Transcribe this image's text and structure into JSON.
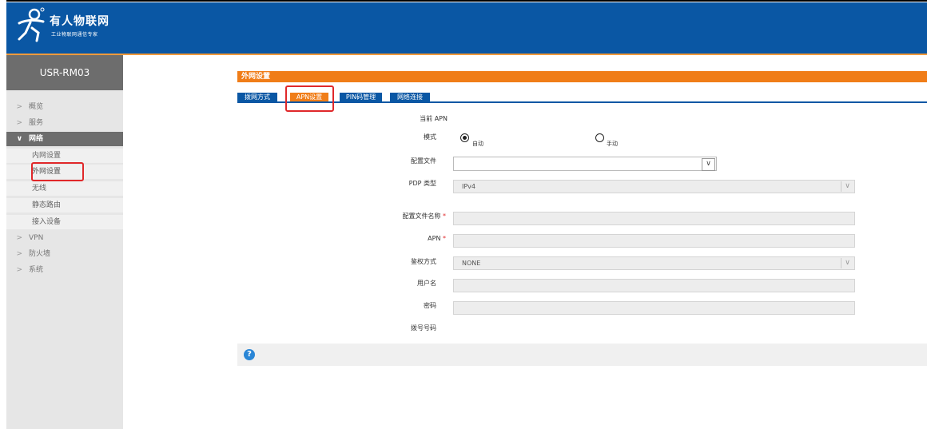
{
  "header": {
    "brand_name": "有人物联网",
    "brand_tagline": "工业物联网通信专家",
    "colors": {
      "header_bg": "#0a57a4",
      "accent": "#f07d18",
      "highlight_box": "#e0282a"
    }
  },
  "sidebar": {
    "device_name": "USR-RM03",
    "items": [
      {
        "label": "概览",
        "expanded": false
      },
      {
        "label": "服务",
        "expanded": false
      },
      {
        "label": "网络",
        "expanded": true
      },
      {
        "label": "VPN",
        "expanded": false
      },
      {
        "label": "防火墙",
        "expanded": false
      },
      {
        "label": "系统",
        "expanded": false
      }
    ],
    "subitems": [
      {
        "label": "内网设置"
      },
      {
        "label": "外网设置"
      },
      {
        "label": "无线"
      },
      {
        "label": "静态路由"
      },
      {
        "label": "接入设备"
      }
    ]
  },
  "main": {
    "section_title": "外网设置",
    "tabs": [
      {
        "label": "拨网方式"
      },
      {
        "label": "APN设置"
      },
      {
        "label": "PIN码管理"
      },
      {
        "label": "网络连接"
      }
    ],
    "form": {
      "current_apn_label": "当前 APN",
      "mode_label": "模式",
      "mode_options": [
        "自动",
        "手动"
      ],
      "mode_selected": "自动",
      "profile_label": "配置文件",
      "profile_value": "",
      "pdp_type_label": "PDP 类型",
      "pdp_type_value": "IPv4",
      "profile_name_label": "配置文件名称",
      "apn_label": "APN",
      "auth_label": "鉴权方式",
      "auth_value": "NONE",
      "username_label": "用户名",
      "password_label": "密码",
      "dial_number_label": "拨号号码",
      "required_mark": "*"
    },
    "help_glyph": "?"
  }
}
